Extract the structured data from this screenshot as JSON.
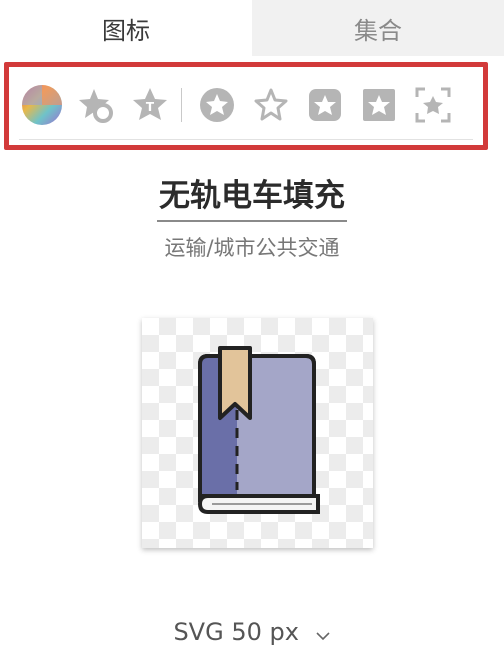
{
  "tabs": [
    {
      "label": "图标",
      "active": true
    },
    {
      "label": "集合",
      "active": false
    }
  ],
  "toolbar": {
    "items": [
      {
        "name": "color-wheel-icon"
      },
      {
        "name": "star-circle-icon"
      },
      {
        "name": "star-text-icon"
      },
      {
        "name": "star-in-circle-icon"
      },
      {
        "name": "star-outline-icon"
      },
      {
        "name": "star-rounded-square-icon"
      },
      {
        "name": "star-square-icon"
      },
      {
        "name": "star-expand-icon"
      }
    ],
    "highlight_color": "#d23a3a"
  },
  "icon": {
    "title": "无轨电车填充",
    "category": "运输/城市公共交通"
  },
  "format": {
    "label": "SVG 50 px"
  }
}
